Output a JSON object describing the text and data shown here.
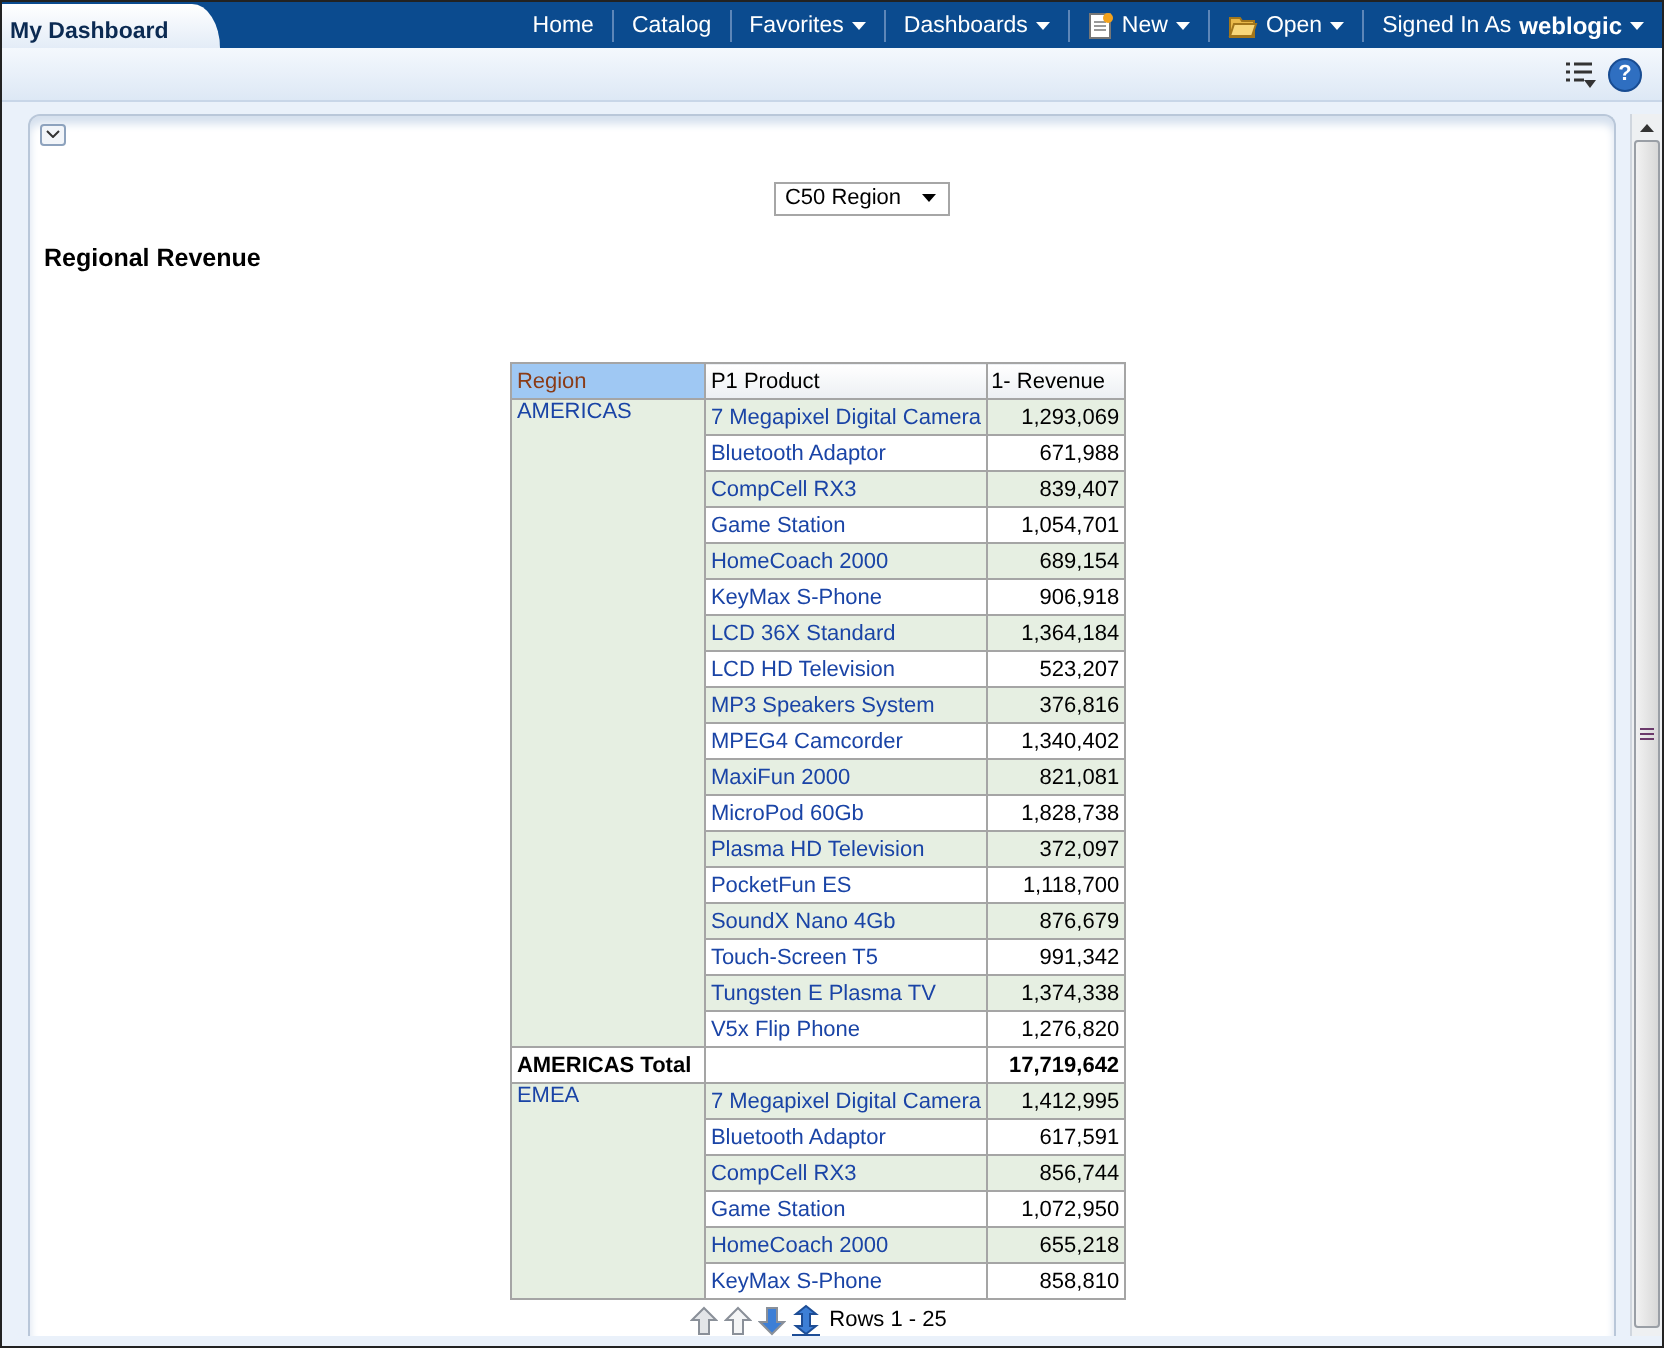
{
  "tab": {
    "title": "My Dashboard"
  },
  "nav": [
    {
      "kind": "link",
      "label": "Home",
      "dropdown": false
    },
    {
      "kind": "link",
      "label": "Catalog",
      "dropdown": false
    },
    {
      "kind": "link",
      "label": "Favorites",
      "dropdown": true
    },
    {
      "kind": "link",
      "label": "Dashboards",
      "dropdown": true
    },
    {
      "kind": "new",
      "label": "New",
      "dropdown": true
    },
    {
      "kind": "open",
      "label": "Open",
      "dropdown": true
    }
  ],
  "signed_in": {
    "label": "Signed In As",
    "user": "weblogic"
  },
  "help": "?",
  "prompt": {
    "value": "C50 Region"
  },
  "report": {
    "title": "Regional Revenue",
    "columns": [
      "Region",
      "P1 Product",
      "1- Revenue"
    ],
    "groups": [
      {
        "region": "AMERICAS",
        "rows": [
          {
            "product": "7 Megapixel Digital Camera",
            "revenue": "1,293,069"
          },
          {
            "product": "Bluetooth Adaptor",
            "revenue": "671,988"
          },
          {
            "product": "CompCell RX3",
            "revenue": "839,407"
          },
          {
            "product": "Game Station",
            "revenue": "1,054,701"
          },
          {
            "product": "HomeCoach 2000",
            "revenue": "689,154"
          },
          {
            "product": "KeyMax S-Phone",
            "revenue": "906,918"
          },
          {
            "product": "LCD 36X Standard",
            "revenue": "1,364,184"
          },
          {
            "product": "LCD HD Television",
            "revenue": "523,207"
          },
          {
            "product": "MP3 Speakers System",
            "revenue": "376,816"
          },
          {
            "product": "MPEG4 Camcorder",
            "revenue": "1,340,402"
          },
          {
            "product": "MaxiFun 2000",
            "revenue": "821,081"
          },
          {
            "product": "MicroPod 60Gb",
            "revenue": "1,828,738"
          },
          {
            "product": "Plasma HD Television",
            "revenue": "372,097"
          },
          {
            "product": "PocketFun ES",
            "revenue": "1,118,700"
          },
          {
            "product": "SoundX Nano 4Gb",
            "revenue": "876,679"
          },
          {
            "product": "Touch-Screen T5",
            "revenue": "991,342"
          },
          {
            "product": "Tungsten E Plasma TV",
            "revenue": "1,374,338"
          },
          {
            "product": "V5x Flip Phone",
            "revenue": "1,276,820"
          }
        ],
        "total": {
          "label": "AMERICAS Total",
          "revenue": "17,719,642"
        }
      },
      {
        "region": "EMEA",
        "rows": [
          {
            "product": "7 Megapixel Digital Camera",
            "revenue": "1,412,995"
          },
          {
            "product": "Bluetooth Adaptor",
            "revenue": "617,591"
          },
          {
            "product": "CompCell RX3",
            "revenue": "856,744"
          },
          {
            "product": "Game Station",
            "revenue": "1,072,950"
          },
          {
            "product": "HomeCoach 2000",
            "revenue": "655,218"
          },
          {
            "product": "KeyMax S-Phone",
            "revenue": "858,810"
          }
        ]
      }
    ],
    "pager": {
      "rows_label": "Rows 1 - 25"
    }
  }
}
